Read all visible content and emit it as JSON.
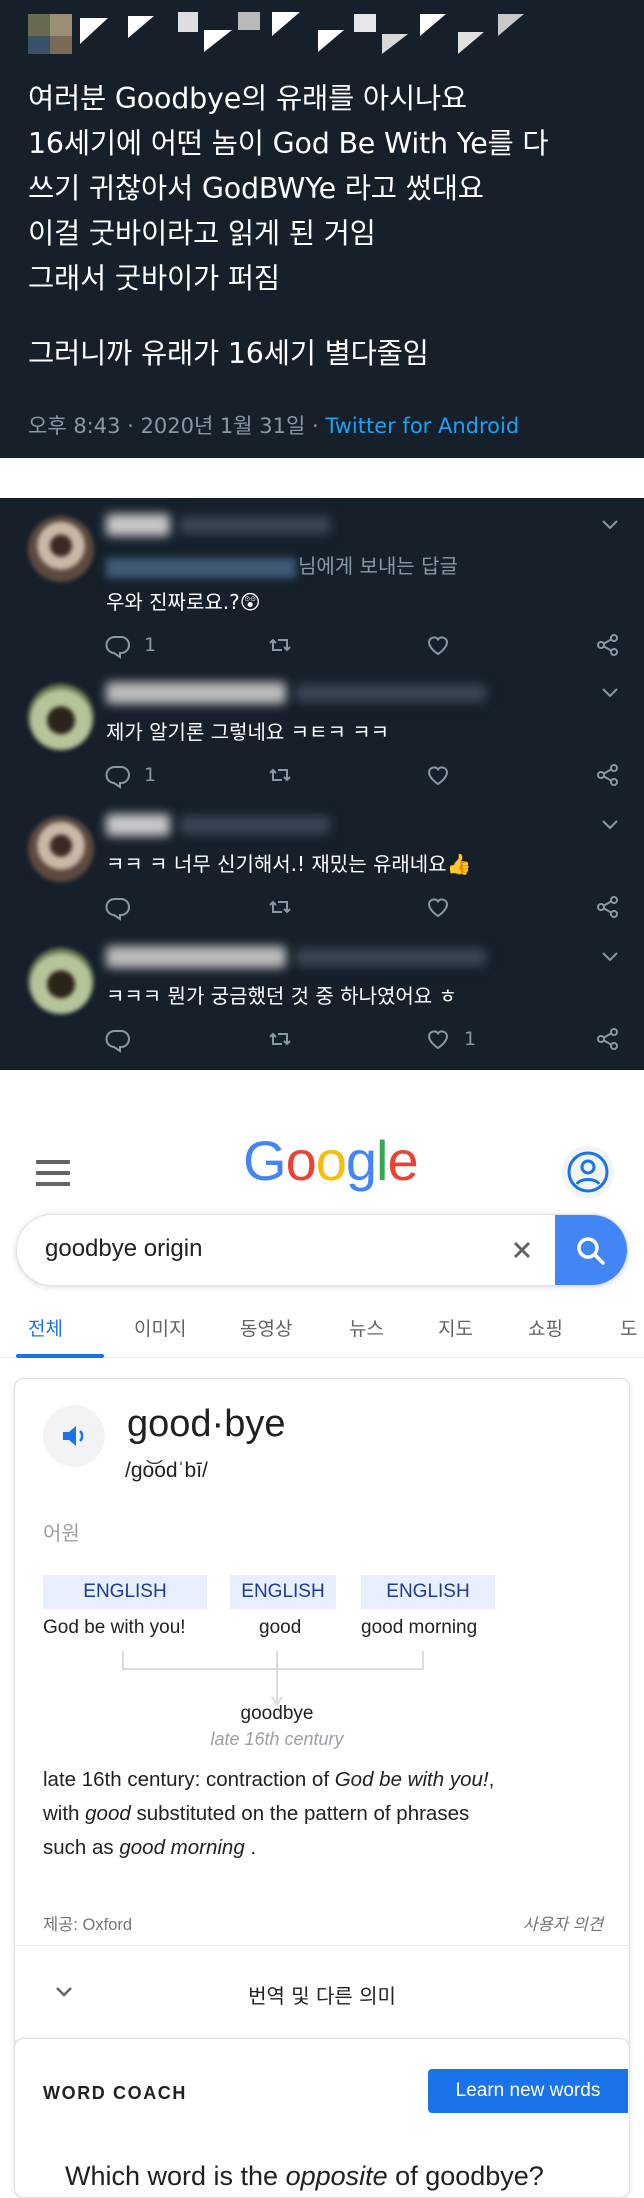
{
  "tweet": {
    "lines": [
      "여러분 Goodbye의 유래를 아시나요",
      "16세기에 어떤 놈이 God Be With Ye를 다",
      "쓰기 귀찮아서 GodBWYe 라고 썼대요",
      "이걸 굿바이라고 읽게 된 거임",
      "그래서 굿바이가 퍼짐",
      "그러니까 유래가 16세기 별다줄임"
    ],
    "time": "오후 8:43 · 2020년 1월 31일 · ",
    "source": "Twitter for Android"
  },
  "replies": [
    {
      "reply_to_suffix": "님에게 보내는 답글",
      "text": "우와 진짜로요.?😲",
      "reply_count": "1",
      "like_count": ""
    },
    {
      "text": "제가 알기론 그렇네요 ㅋㅌㅋ ㅋㅋ",
      "reply_count": "1",
      "like_count": ""
    },
    {
      "text": "ㅋㅋ ㅋ 너무 신기해서.! 재밌는 유래네요👍",
      "reply_count": "",
      "like_count": ""
    },
    {
      "text": "ㅋㅋㅋ 뭔가 궁금했던 것 중 하나였어요 ㅎ",
      "reply_count": "",
      "like_count": "1"
    }
  ],
  "google": {
    "logo": "Google",
    "search_value": "goodbye origin",
    "tabs": [
      "전체",
      "이미지",
      "동영상",
      "뉴스",
      "지도",
      "쇼핑",
      "도"
    ]
  },
  "dictionary": {
    "word": "good·bye",
    "pronunciation": "/go͝odˈbī/",
    "etymology_label": "어원",
    "origins": [
      {
        "lang": "ENGLISH",
        "word": "God be with you!"
      },
      {
        "lang": "ENGLISH",
        "word": "good"
      },
      {
        "lang": "ENGLISH",
        "word": "good morning"
      }
    ],
    "result_word": "goodbye",
    "result_period": "late 16th century",
    "desc_1": "late 16th century: contraction of ",
    "desc_2": "God be with you!",
    "desc_3": ",",
    "desc_4": "with ",
    "desc_5": "good",
    "desc_6": " substituted on the pattern of phrases",
    "desc_7": "such as ",
    "desc_8": "good morning",
    "desc_9": " .",
    "source": "제공: Oxford",
    "feedback": "사용자 의견",
    "expand_label": "번역 및 다른 의미"
  },
  "word_coach": {
    "title": "WORD COACH",
    "button": "Learn new words",
    "question_1": "Which word is the ",
    "question_2": "opposite",
    "question_3": " of goodbye?"
  },
  "colors": {
    "twitter_bg": "#15202b",
    "twitter_muted": "#8899a6",
    "twitter_link": "#1da1f2",
    "google_blue": "#4285f4",
    "tab_active": "#1a73e8",
    "ety_box": "#e8f0fe"
  },
  "icons": [
    "reply-icon",
    "retweet-icon",
    "like-icon",
    "share-icon",
    "chevron-down-icon",
    "menu-icon",
    "account-icon",
    "clear-icon",
    "search-icon",
    "speaker-icon"
  ]
}
